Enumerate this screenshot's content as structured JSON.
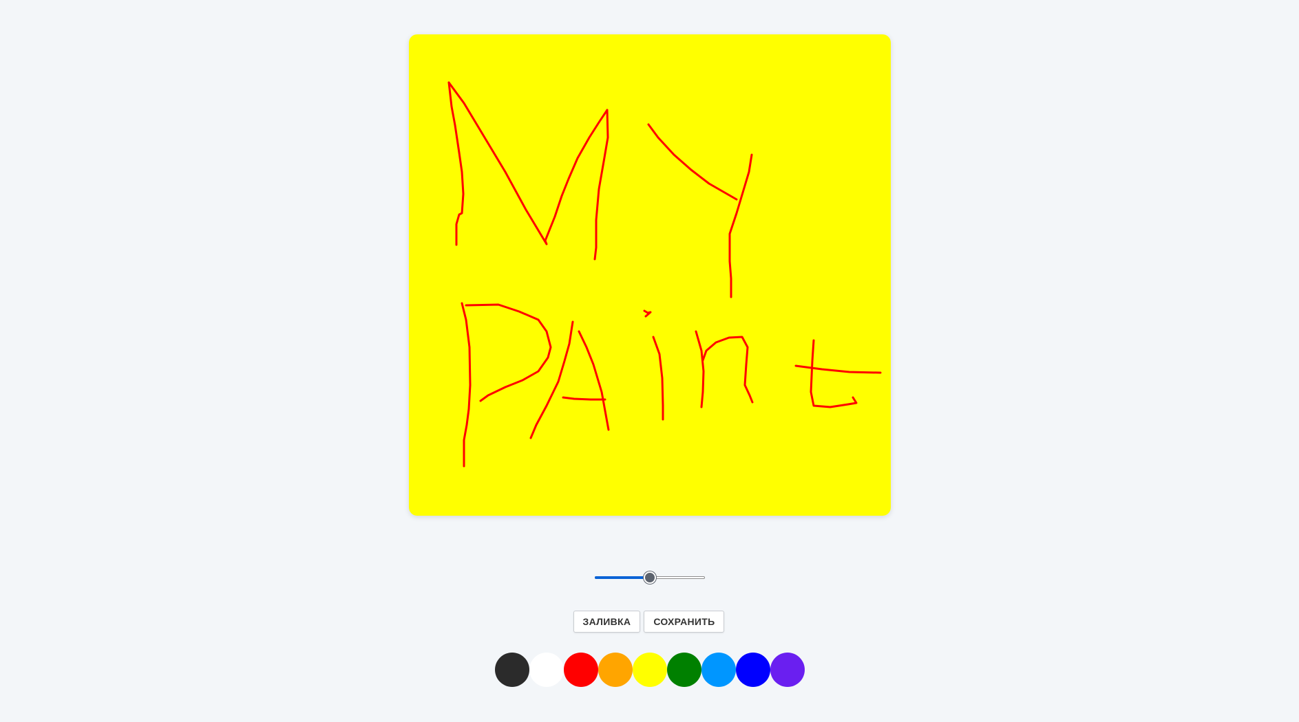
{
  "canvas": {
    "background": "#ffff00",
    "stroke_color": "#ff0000"
  },
  "brush_size": {
    "value": 0.5
  },
  "toolbar": {
    "fill_label": "ЗАЛИВКА",
    "save_label": "СОХРАНИТЬ"
  },
  "palette": [
    {
      "name": "black",
      "color": "#2b2b2b"
    },
    {
      "name": "white",
      "color": "#ffffff"
    },
    {
      "name": "red",
      "color": "#ff0000"
    },
    {
      "name": "orange",
      "color": "#ffa500"
    },
    {
      "name": "yellow",
      "color": "#ffff00"
    },
    {
      "name": "green",
      "color": "#008000"
    },
    {
      "name": "light-blue",
      "color": "#0096ff"
    },
    {
      "name": "blue",
      "color": "#0000ff"
    },
    {
      "name": "purple",
      "color": "#6a1ff0"
    }
  ]
}
